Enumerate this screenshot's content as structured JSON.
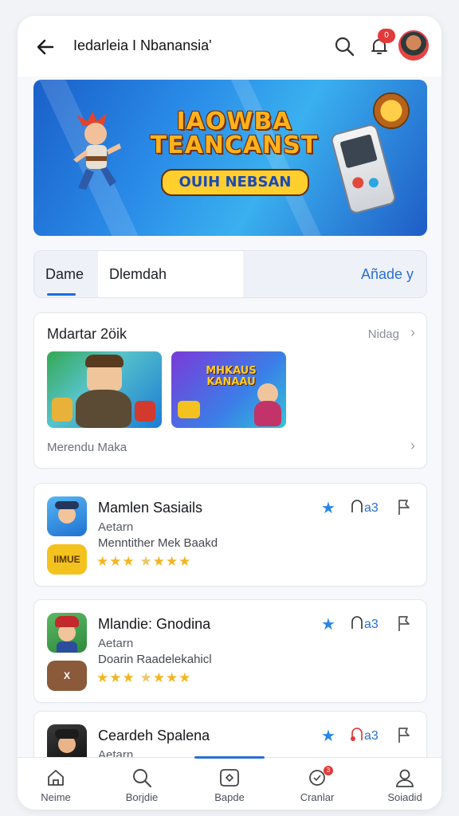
{
  "header": {
    "title": "Iedarleia I Nbanansia'",
    "notification_count": "0"
  },
  "banner": {
    "title_line1": "IAOWBA",
    "title_line2": "TEANCANST",
    "subtitle": "OUIH NEBSAN"
  },
  "tabs": [
    {
      "label": "Dame",
      "active": true
    },
    {
      "label": "Dlemdah"
    },
    {
      "label": "Añade y"
    }
  ],
  "featured": {
    "title": "Mdartar 2öik",
    "more_label": "Nidag",
    "thumb2_title": "MHKAUS KANAAU",
    "footer_label": "Merendu Maka"
  },
  "games": [
    {
      "name": "Mamlen Sasiails",
      "subtitle": "Aetarn",
      "description": "Menntither Mek Baakd",
      "rating_count": "a3",
      "badge": "IIMUE",
      "badge_color": "#f4c21e"
    },
    {
      "name": "Mlandie: Gnodina",
      "subtitle": "Aetarn",
      "description": "Doarin Raadelekahicl",
      "rating_count": "a3",
      "badge": "X",
      "badge_color": "#8a5a3a"
    },
    {
      "name": "Ceardeh Spalena",
      "subtitle": "Aetarn",
      "description": "",
      "rating_count": "a3"
    }
  ],
  "bottom_nav": [
    {
      "label": "Neime",
      "icon": "home-icon"
    },
    {
      "label": "Borjdie",
      "icon": "search-icon"
    },
    {
      "label": "Bapde",
      "icon": "games-icon"
    },
    {
      "label": "Cranlar",
      "icon": "chat-icon",
      "badge": "3"
    },
    {
      "label": "Soiadid",
      "icon": "profile-icon"
    }
  ],
  "colors": {
    "accent": "#2a6fd3",
    "star": "#f3b61f",
    "badge_red": "#e23a3a"
  }
}
